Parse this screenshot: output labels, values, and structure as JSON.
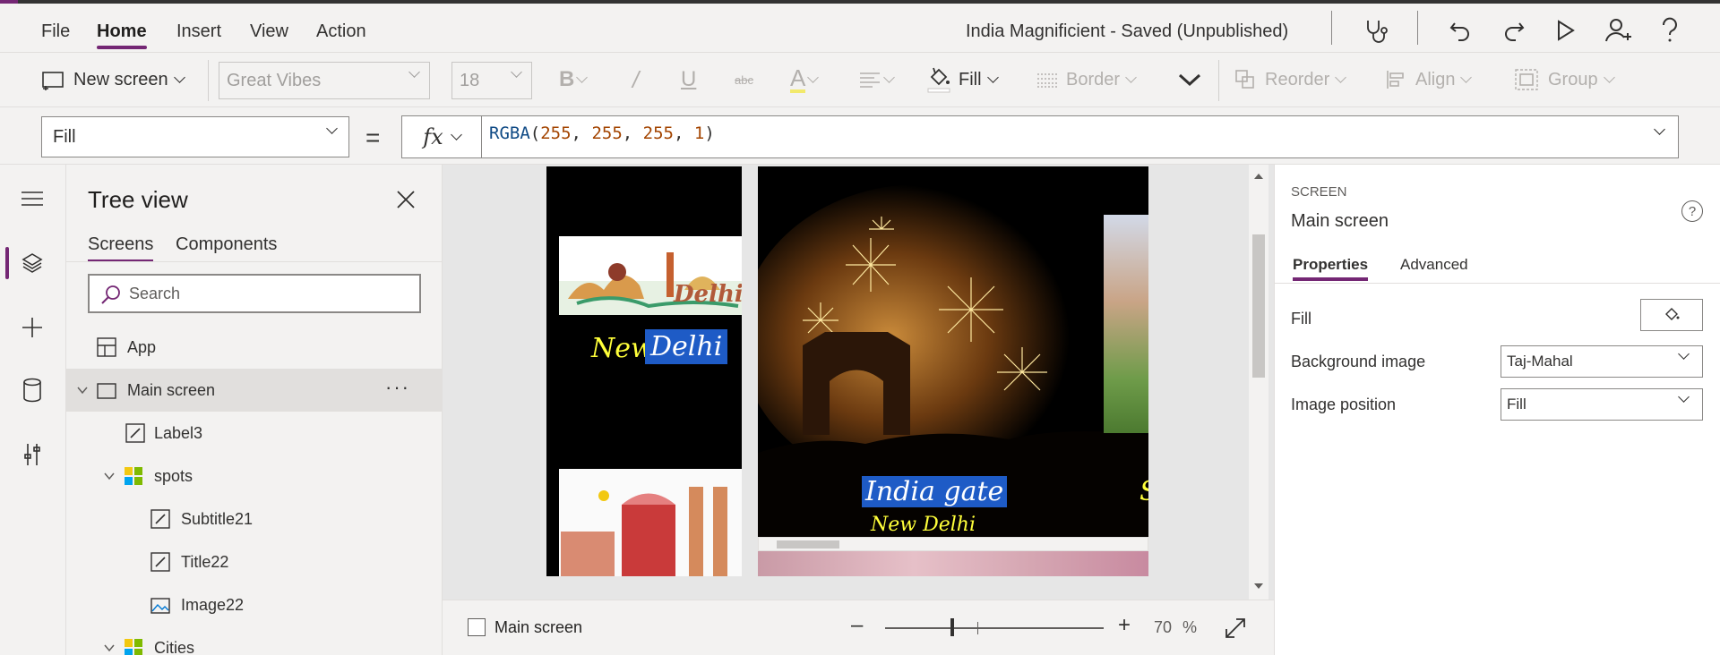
{
  "menubar": {
    "items": [
      "File",
      "Home",
      "Insert",
      "View",
      "Action"
    ],
    "active": "Home",
    "app_title": "India Magnificient - Saved (Unpublished)"
  },
  "ribbon": {
    "new_screen": "New screen",
    "font": "Great Vibes",
    "font_size": "18",
    "fill": "Fill",
    "border": "Border",
    "reorder": "Reorder",
    "align": "Align",
    "group": "Group"
  },
  "formula_bar": {
    "property": "Fill",
    "equals": "=",
    "fx": "fx",
    "formula_fn": "RGBA",
    "formula_args": [
      "255",
      "255",
      "255",
      "1"
    ]
  },
  "tree": {
    "title": "Tree view",
    "tabs": [
      "Screens",
      "Components"
    ],
    "search_placeholder": "Search",
    "nodes": [
      {
        "label": "App"
      },
      {
        "label": "Main screen",
        "more": "···"
      },
      {
        "label": "Label3"
      },
      {
        "label": "spots"
      },
      {
        "label": "Subtitle21"
      },
      {
        "label": "Title22"
      },
      {
        "label": "Image22"
      },
      {
        "label": "Cities"
      }
    ]
  },
  "canvas": {
    "city_word_1": "New",
    "city_word_2": "Delhi",
    "caption_main": "India gate",
    "caption_sub": "New Delhi",
    "clip_logo_text": "Delhi",
    "edge_char": "S"
  },
  "statusbar": {
    "screen_name": "Main screen",
    "zoom_value": "70",
    "zoom_unit": "%",
    "zoom_fraction": 0.7
  },
  "properties": {
    "kind": "SCREEN",
    "name": "Main screen",
    "help": "?",
    "tabs": [
      "Properties",
      "Advanced"
    ],
    "fill_label": "Fill",
    "bg_image_label": "Background image",
    "bg_image_value": "Taj-Mahal",
    "image_position_label": "Image position",
    "image_position_value": "Fill"
  },
  "colors": {
    "accent": "#742774",
    "tag_bg": "#1e5bc6",
    "tag_text": "#ffff3a"
  }
}
